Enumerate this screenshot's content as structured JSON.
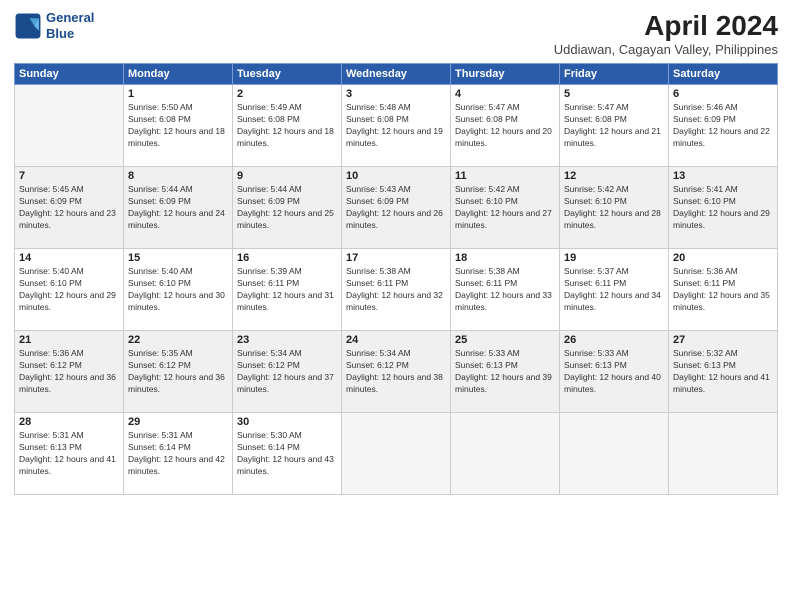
{
  "header": {
    "logo_line1": "General",
    "logo_line2": "Blue",
    "title": "April 2024",
    "subtitle": "Uddiawan, Cagayan Valley, Philippines"
  },
  "weekdays": [
    "Sunday",
    "Monday",
    "Tuesday",
    "Wednesday",
    "Thursday",
    "Friday",
    "Saturday"
  ],
  "weeks": [
    [
      {
        "day": "",
        "empty": true
      },
      {
        "day": "1",
        "sunrise": "5:50 AM",
        "sunset": "6:08 PM",
        "daylight": "12 hours and 18 minutes."
      },
      {
        "day": "2",
        "sunrise": "5:49 AM",
        "sunset": "6:08 PM",
        "daylight": "12 hours and 18 minutes."
      },
      {
        "day": "3",
        "sunrise": "5:48 AM",
        "sunset": "6:08 PM",
        "daylight": "12 hours and 19 minutes."
      },
      {
        "day": "4",
        "sunrise": "5:47 AM",
        "sunset": "6:08 PM",
        "daylight": "12 hours and 20 minutes."
      },
      {
        "day": "5",
        "sunrise": "5:47 AM",
        "sunset": "6:08 PM",
        "daylight": "12 hours and 21 minutes."
      },
      {
        "day": "6",
        "sunrise": "5:46 AM",
        "sunset": "6:09 PM",
        "daylight": "12 hours and 22 minutes."
      }
    ],
    [
      {
        "day": "7",
        "sunrise": "5:45 AM",
        "sunset": "6:09 PM",
        "daylight": "12 hours and 23 minutes."
      },
      {
        "day": "8",
        "sunrise": "5:44 AM",
        "sunset": "6:09 PM",
        "daylight": "12 hours and 24 minutes."
      },
      {
        "day": "9",
        "sunrise": "5:44 AM",
        "sunset": "6:09 PM",
        "daylight": "12 hours and 25 minutes."
      },
      {
        "day": "10",
        "sunrise": "5:43 AM",
        "sunset": "6:09 PM",
        "daylight": "12 hours and 26 minutes."
      },
      {
        "day": "11",
        "sunrise": "5:42 AM",
        "sunset": "6:10 PM",
        "daylight": "12 hours and 27 minutes."
      },
      {
        "day": "12",
        "sunrise": "5:42 AM",
        "sunset": "6:10 PM",
        "daylight": "12 hours and 28 minutes."
      },
      {
        "day": "13",
        "sunrise": "5:41 AM",
        "sunset": "6:10 PM",
        "daylight": "12 hours and 29 minutes."
      }
    ],
    [
      {
        "day": "14",
        "sunrise": "5:40 AM",
        "sunset": "6:10 PM",
        "daylight": "12 hours and 29 minutes."
      },
      {
        "day": "15",
        "sunrise": "5:40 AM",
        "sunset": "6:10 PM",
        "daylight": "12 hours and 30 minutes."
      },
      {
        "day": "16",
        "sunrise": "5:39 AM",
        "sunset": "6:11 PM",
        "daylight": "12 hours and 31 minutes."
      },
      {
        "day": "17",
        "sunrise": "5:38 AM",
        "sunset": "6:11 PM",
        "daylight": "12 hours and 32 minutes."
      },
      {
        "day": "18",
        "sunrise": "5:38 AM",
        "sunset": "6:11 PM",
        "daylight": "12 hours and 33 minutes."
      },
      {
        "day": "19",
        "sunrise": "5:37 AM",
        "sunset": "6:11 PM",
        "daylight": "12 hours and 34 minutes."
      },
      {
        "day": "20",
        "sunrise": "5:36 AM",
        "sunset": "6:11 PM",
        "daylight": "12 hours and 35 minutes."
      }
    ],
    [
      {
        "day": "21",
        "sunrise": "5:36 AM",
        "sunset": "6:12 PM",
        "daylight": "12 hours and 36 minutes."
      },
      {
        "day": "22",
        "sunrise": "5:35 AM",
        "sunset": "6:12 PM",
        "daylight": "12 hours and 36 minutes."
      },
      {
        "day": "23",
        "sunrise": "5:34 AM",
        "sunset": "6:12 PM",
        "daylight": "12 hours and 37 minutes."
      },
      {
        "day": "24",
        "sunrise": "5:34 AM",
        "sunset": "6:12 PM",
        "daylight": "12 hours and 38 minutes."
      },
      {
        "day": "25",
        "sunrise": "5:33 AM",
        "sunset": "6:13 PM",
        "daylight": "12 hours and 39 minutes."
      },
      {
        "day": "26",
        "sunrise": "5:33 AM",
        "sunset": "6:13 PM",
        "daylight": "12 hours and 40 minutes."
      },
      {
        "day": "27",
        "sunrise": "5:32 AM",
        "sunset": "6:13 PM",
        "daylight": "12 hours and 41 minutes."
      }
    ],
    [
      {
        "day": "28",
        "sunrise": "5:31 AM",
        "sunset": "6:13 PM",
        "daylight": "12 hours and 41 minutes."
      },
      {
        "day": "29",
        "sunrise": "5:31 AM",
        "sunset": "6:14 PM",
        "daylight": "12 hours and 42 minutes."
      },
      {
        "day": "30",
        "sunrise": "5:30 AM",
        "sunset": "6:14 PM",
        "daylight": "12 hours and 43 minutes."
      },
      {
        "day": "",
        "empty": true
      },
      {
        "day": "",
        "empty": true
      },
      {
        "day": "",
        "empty": true
      },
      {
        "day": "",
        "empty": true
      }
    ]
  ]
}
